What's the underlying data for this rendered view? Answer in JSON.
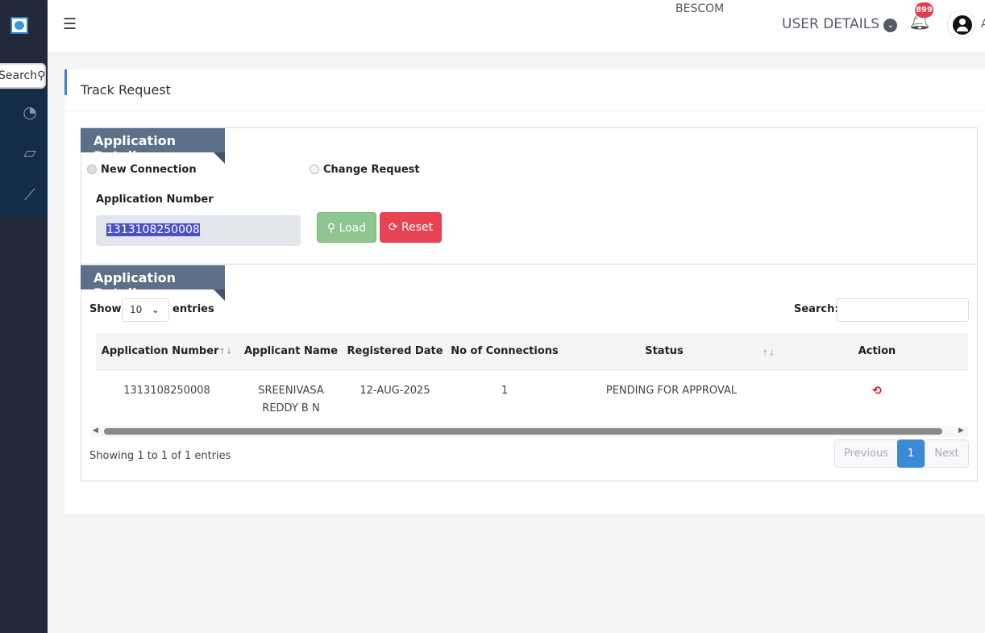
{
  "header": {
    "brand_alt": "BESCOM",
    "user_details": "USER DETAILS",
    "notification_count": "899",
    "user_initial": "A",
    "menu_icon": "hamburger-icon"
  },
  "sidebar": {
    "search_label": "Search",
    "items": [
      {
        "icon": "dashboard-icon"
      },
      {
        "icon": "ticket-icon"
      },
      {
        "icon": "chart-line-icon"
      }
    ]
  },
  "page": {
    "title": "Track Request"
  },
  "form": {
    "section_title": "Application Details",
    "radio_new": "New Connection",
    "radio_change": "Change Request",
    "selected": "New Connection",
    "app_number_label": "Application Number",
    "app_number_value": "1313108250008",
    "load_label": "Load",
    "reset_label": "Reset"
  },
  "results": {
    "section_title": "Application Details",
    "show_label": "Show",
    "page_length": "10",
    "entries_label": "entries",
    "search_label": "Search:",
    "search_value": "",
    "columns": [
      "Application Number",
      "Applicant Name",
      "Registered Date",
      "No of Connections",
      "Status",
      "Action"
    ],
    "rows": [
      {
        "application_number": "1313108250008",
        "applicant_name_1": "SREENIVASA",
        "applicant_name_2": "REDDY B N",
        "registered_date": "12-AUG-2025",
        "connections": "1",
        "status": "PENDING FOR APPROVAL",
        "action_icon": "history-icon"
      }
    ],
    "info": "Showing 1 to 1 of 1 entries",
    "previous": "Previous",
    "current_page": "1",
    "next": "Next"
  },
  "colors": {
    "ribbon": "#5d7089",
    "load": "#8fc58f",
    "reset": "#e84353",
    "page_active": "#3a8ad6",
    "badge": "#e23c4e"
  }
}
